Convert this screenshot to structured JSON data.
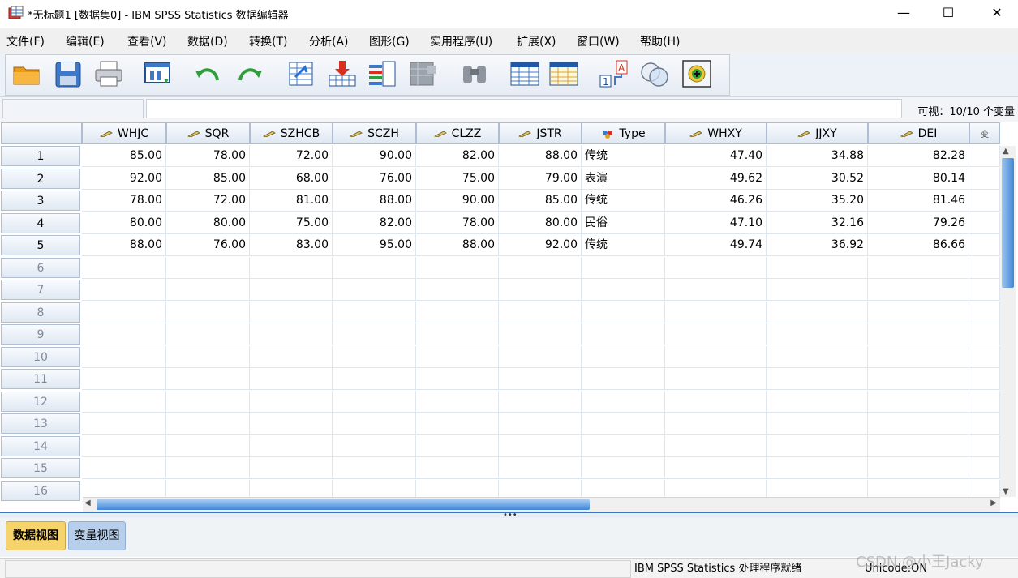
{
  "window": {
    "title": "*无标题1 [数据集0] - IBM SPSS Statistics 数据编辑器",
    "minimize": "—",
    "maximize": "☐",
    "close": "✕"
  },
  "menu": [
    "文件(F)",
    "编辑(E)",
    "查看(V)",
    "数据(D)",
    "转换(T)",
    "分析(A)",
    "图形(G)",
    "实用程序(U)",
    "扩展(X)",
    "窗口(W)",
    "帮助(H)"
  ],
  "toolbar": [
    "open-icon",
    "save-icon",
    "print-icon",
    "dialog-recall-icon",
    "undo-icon",
    "redo-icon",
    "goto-case-icon",
    "goto-variable-icon",
    "variables-icon",
    "run-descriptive-icon",
    "find-icon",
    "insert-cases-icon",
    "insert-variable-icon",
    "split-file-icon",
    "select-cases-icon",
    "value-labels-icon"
  ],
  "cellbar": {
    "name": "",
    "value": "",
    "visible": "可视：10/10 个变量"
  },
  "columns": [
    {
      "name": "WHJC",
      "kind": "scale"
    },
    {
      "name": "SQR",
      "kind": "scale"
    },
    {
      "name": "SZHCB",
      "kind": "scale"
    },
    {
      "name": "SCZH",
      "kind": "scale"
    },
    {
      "name": "CLZZ",
      "kind": "scale"
    },
    {
      "name": "JSTR",
      "kind": "scale"
    },
    {
      "name": "Type",
      "kind": "nominal"
    },
    {
      "name": "WHXY",
      "kind": "scale"
    },
    {
      "name": "JJXY",
      "kind": "scale"
    },
    {
      "name": "DEI",
      "kind": "scale"
    },
    {
      "name": "变",
      "kind": "partial"
    }
  ],
  "rows": [
    [
      "85.00",
      "78.00",
      "72.00",
      "90.00",
      "82.00",
      "88.00",
      "传统",
      "47.40",
      "34.88",
      "82.28"
    ],
    [
      "92.00",
      "85.00",
      "68.00",
      "76.00",
      "75.00",
      "79.00",
      "表演",
      "49.62",
      "30.52",
      "80.14"
    ],
    [
      "78.00",
      "72.00",
      "81.00",
      "88.00",
      "90.00",
      "85.00",
      "传统",
      "46.26",
      "35.20",
      "81.46"
    ],
    [
      "80.00",
      "80.00",
      "75.00",
      "82.00",
      "78.00",
      "80.00",
      "民俗",
      "47.10",
      "32.16",
      "79.26"
    ],
    [
      "88.00",
      "76.00",
      "83.00",
      "95.00",
      "88.00",
      "92.00",
      "传统",
      "49.74",
      "36.92",
      "86.66"
    ]
  ],
  "row_numbers": [
    "1",
    "2",
    "3",
    "4",
    "5",
    "6",
    "7",
    "8",
    "9",
    "10",
    "11",
    "12",
    "13",
    "14",
    "15",
    "16"
  ],
  "tabs": {
    "data_view": "数据视图",
    "variable_view": "变量视图"
  },
  "status": {
    "processor": "IBM SPSS Statistics 处理程序就绪",
    "unicode": "Unicode:ON"
  },
  "watermark": "CSDN @小王Jacky",
  "colors": {
    "accent": "#3c74c2",
    "active_tab": "#f7d36b",
    "inactive_tab": "#b7cfea"
  }
}
